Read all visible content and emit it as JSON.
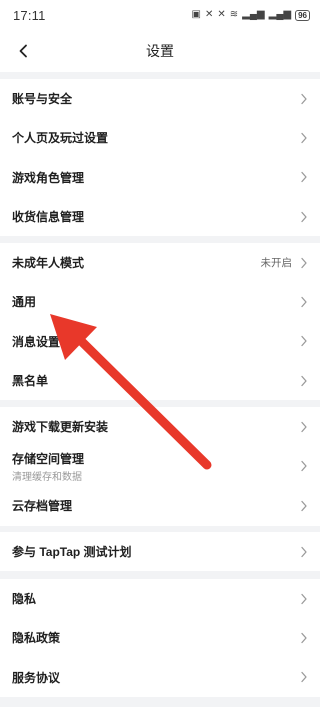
{
  "status_bar": {
    "time": "17:11",
    "battery": "96"
  },
  "header": {
    "title": "设置"
  },
  "groups": [
    {
      "items": [
        {
          "label": "账号与安全"
        },
        {
          "label": "个人页及玩过设置"
        },
        {
          "label": "游戏角色管理"
        },
        {
          "label": "收货信息管理"
        }
      ]
    },
    {
      "items": [
        {
          "label": "未成年人模式",
          "status": "未开启"
        },
        {
          "label": "通用"
        },
        {
          "label": "消息设置"
        },
        {
          "label": "黑名单"
        }
      ]
    },
    {
      "items": [
        {
          "label": "游戏下载更新安装"
        },
        {
          "label": "存储空间管理",
          "sub": "清理缓存和数据"
        },
        {
          "label": "云存档管理"
        }
      ]
    },
    {
      "items": [
        {
          "label": "参与 TapTap 测试计划"
        }
      ]
    },
    {
      "items": [
        {
          "label": "隐私"
        },
        {
          "label": "隐私政策"
        },
        {
          "label": "服务协议"
        }
      ]
    }
  ],
  "colors": {
    "arrow": "#e8382a",
    "background": "#f2f3f5"
  },
  "icons": {
    "back": "chevron-left-icon",
    "row_chevron": "chevron-right-icon"
  }
}
